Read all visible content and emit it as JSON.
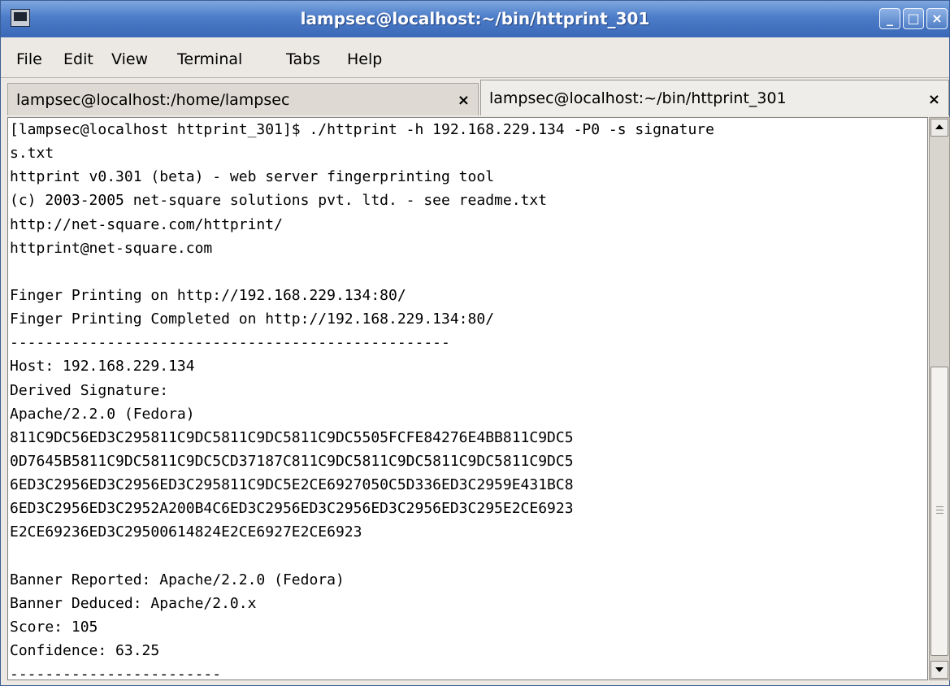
{
  "window": {
    "title": "lampsec@localhost:~/bin/httprint_301",
    "controls": {
      "minimize": "_",
      "maximize": "□",
      "close": "×"
    }
  },
  "menubar": {
    "items": [
      {
        "label": "File"
      },
      {
        "label": "Edit"
      },
      {
        "label": "View"
      },
      {
        "label": "Terminal"
      },
      {
        "label": "Tabs"
      },
      {
        "label": "Help"
      }
    ]
  },
  "tabs": [
    {
      "label": "lampsec@localhost:/home/lampsec",
      "close": "×",
      "active": false
    },
    {
      "label": "lampsec@localhost:~/bin/httprint_301",
      "close": "×",
      "active": true
    }
  ],
  "terminal": {
    "lines": [
      "[lampsec@localhost httprint_301]$ ./httprint -h 192.168.229.134 -P0 -s signature",
      "s.txt",
      "httprint v0.301 (beta) - web server fingerprinting tool",
      "(c) 2003-2005 net-square solutions pvt. ltd. - see readme.txt",
      "http://net-square.com/httprint/",
      "httprint@net-square.com",
      "",
      "Finger Printing on http://192.168.229.134:80/",
      "Finger Printing Completed on http://192.168.229.134:80/",
      "--------------------------------------------------",
      "Host: 192.168.229.134",
      "Derived Signature:",
      "Apache/2.2.0 (Fedora)",
      "811C9DC56ED3C295811C9DC5811C9DC5811C9DC5505FCFE84276E4BB811C9DC5",
      "0D7645B5811C9DC5811C9DC5CD37187C811C9DC5811C9DC5811C9DC5811C9DC5",
      "6ED3C2956ED3C2956ED3C295811C9DC5E2CE6927050C5D336ED3C2959E431BC8",
      "6ED3C2956ED3C2952A200B4C6ED3C2956ED3C2956ED3C2956ED3C295E2CE6923",
      "E2CE69236ED3C29500614824E2CE6927E2CE6923",
      "",
      "Banner Reported: Apache/2.2.0 (Fedora)",
      "Banner Deduced: Apache/2.0.x",
      "Score: 105",
      "Confidence: 63.25",
      "------------------------"
    ]
  },
  "scrollbar": {
    "position_fraction": 0.58
  },
  "colors": {
    "titlebar": "#4c7cc8",
    "terminal_bg": "#ffffff",
    "terminal_fg": "#000000"
  }
}
